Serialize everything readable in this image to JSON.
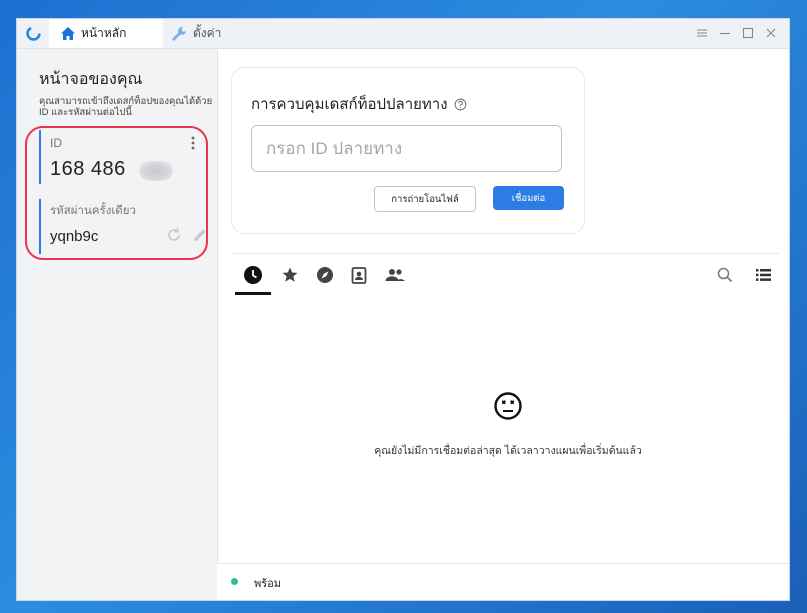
{
  "titlebar": {
    "tabs": [
      {
        "label": "หน้าหลัก",
        "icon": "home-icon",
        "active": true
      },
      {
        "label": "ตั้งค่า",
        "icon": "wrench-icon",
        "active": false
      }
    ],
    "controls": [
      "menu-icon",
      "minimize-icon",
      "maximize-icon",
      "close-icon"
    ]
  },
  "sidebar": {
    "title": "หน้าจอของคุณ",
    "description": "คุณสามารถเข้าถึงเดสก์ท็อปของคุณได้ด้วย ID และรหัสผ่านต่อไปนี้",
    "id_label": "ID",
    "id_value": "168 486",
    "password_label": "รหัสผ่านครั้งเดียว",
    "password_value": "yqnb9c"
  },
  "connect": {
    "title": "การควบคุมเดสก์ท็อปปลายทาง",
    "input_placeholder": "กรอก ID ปลายทาง",
    "transfer_button": "การถ่ายโอนไฟล์",
    "connect_button": "เชื่อมต่อ"
  },
  "peers": {
    "tabs": [
      "recent-icon",
      "favorites-icon",
      "discover-icon",
      "address-book-icon",
      "group-icon"
    ],
    "active_tab": "recent-icon",
    "empty_message": "คุณยังไม่มีการเชื่อมต่อล่าสุด ได้เวลาวางแผนเพื่อเริ่มต้นแล้ว"
  },
  "status": {
    "text": "พร้อม",
    "color": "#31bf83"
  },
  "colors": {
    "accent": "#2d7be5",
    "highlight": "#e8344e"
  }
}
